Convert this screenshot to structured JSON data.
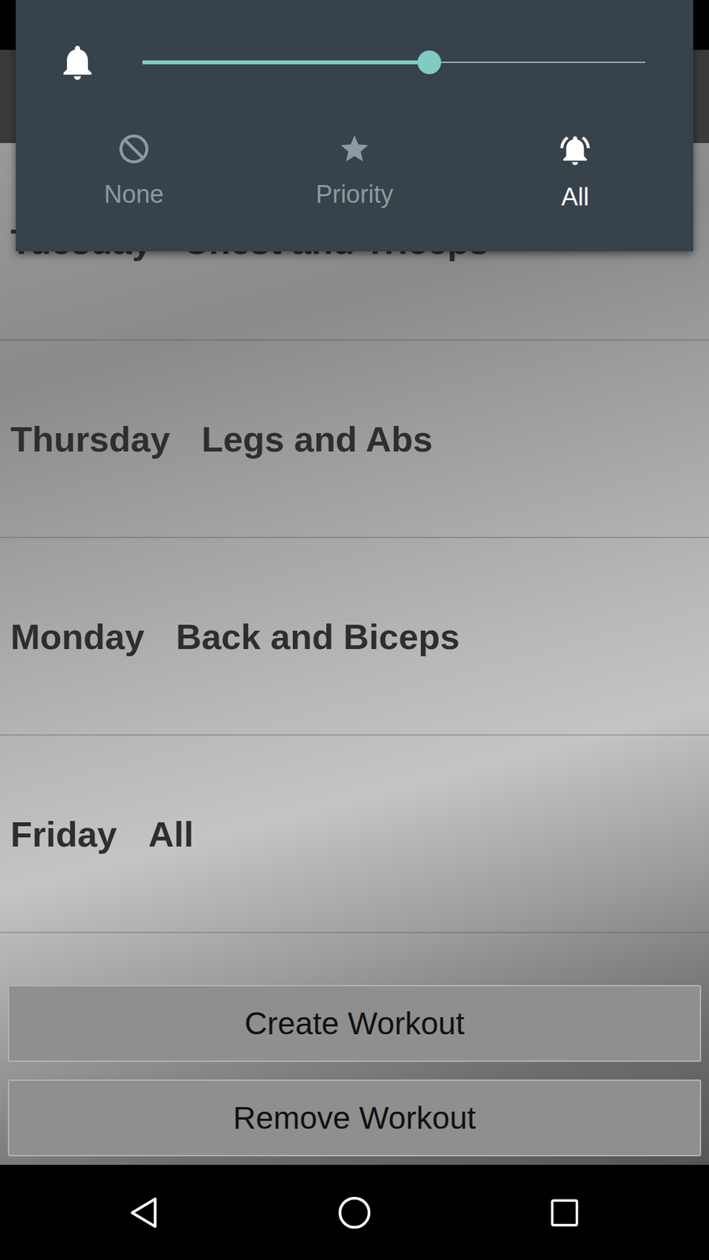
{
  "volume_panel": {
    "level": 0.57,
    "modes": [
      {
        "label": "None",
        "selected": false
      },
      {
        "label": "Priority",
        "selected": false
      },
      {
        "label": "All",
        "selected": true
      }
    ]
  },
  "workouts": [
    {
      "day": "Tuesday",
      "name": "Chest and Triceps"
    },
    {
      "day": "Thursday",
      "name": "Legs and Abs"
    },
    {
      "day": "Monday",
      "name": "Back and Biceps"
    },
    {
      "day": "Friday",
      "name": "All"
    }
  ],
  "buttons": [
    "Create Workout",
    "Remove Workout"
  ]
}
